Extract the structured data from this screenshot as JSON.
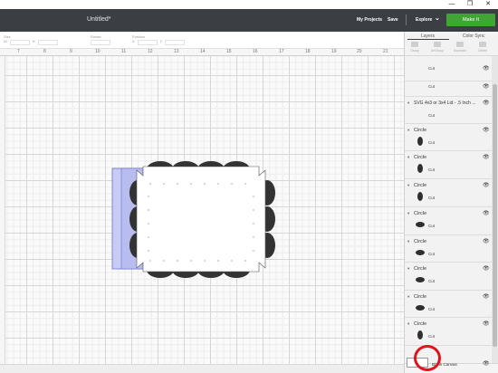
{
  "window": {
    "controls": {
      "minimize": "—",
      "restore": "❐",
      "close": "✕"
    }
  },
  "header": {
    "doc_title": "Untitled*",
    "my_projects": "My Projects",
    "save": "Save",
    "explore": "Explore",
    "explore_chevron": "⌄",
    "make_it": "Make It",
    "make_it_color": "#3fa535",
    "bar_color": "#3b3f44"
  },
  "toolbar": {
    "groups": [
      {
        "label": "Size"
      },
      {
        "label": "Rotate"
      },
      {
        "label": "Position"
      }
    ],
    "w_label": "W",
    "h_label": "H",
    "x_label": "X",
    "y_label": "Y"
  },
  "ruler": {
    "ticks": [
      "7",
      "8",
      "9",
      "10",
      "11",
      "12",
      "13",
      "14",
      "15",
      "16",
      "17",
      "18",
      "19",
      "20",
      "21"
    ]
  },
  "panel": {
    "tabs": [
      "Layers",
      "Color Sync"
    ],
    "actions": [
      "Group",
      "UnGroup",
      "Duplicate",
      "Delete"
    ],
    "layers": [
      {
        "name": "",
        "op": "Cut",
        "shape": "none"
      },
      {
        "name": "",
        "op": "Cut",
        "shape": "none"
      },
      {
        "name": "SVG 4x3 or 3x4 Lid - .5 Inch ...",
        "op": "Cut",
        "shape": "none"
      },
      {
        "name": "Circle",
        "op": "Cut",
        "shape": "v"
      },
      {
        "name": "Circle",
        "op": "Cut",
        "shape": "v"
      },
      {
        "name": "Circle",
        "op": "Cut",
        "shape": "v"
      },
      {
        "name": "Circle",
        "op": "Cut",
        "shape": "h"
      },
      {
        "name": "Circle",
        "op": "Cut",
        "shape": "h"
      },
      {
        "name": "Circle",
        "op": "Cut",
        "shape": "h"
      },
      {
        "name": "Circle",
        "op": "Cut",
        "shape": "h"
      },
      {
        "name": "Circle",
        "op": "Cut",
        "shape": "v"
      }
    ],
    "blank_canvas": "Blank Canvas",
    "eye_icon": "👁",
    "chevron_icon": "▾"
  },
  "icons": {
    "eye": "eye-icon",
    "chevron": "chevron-down-icon"
  }
}
